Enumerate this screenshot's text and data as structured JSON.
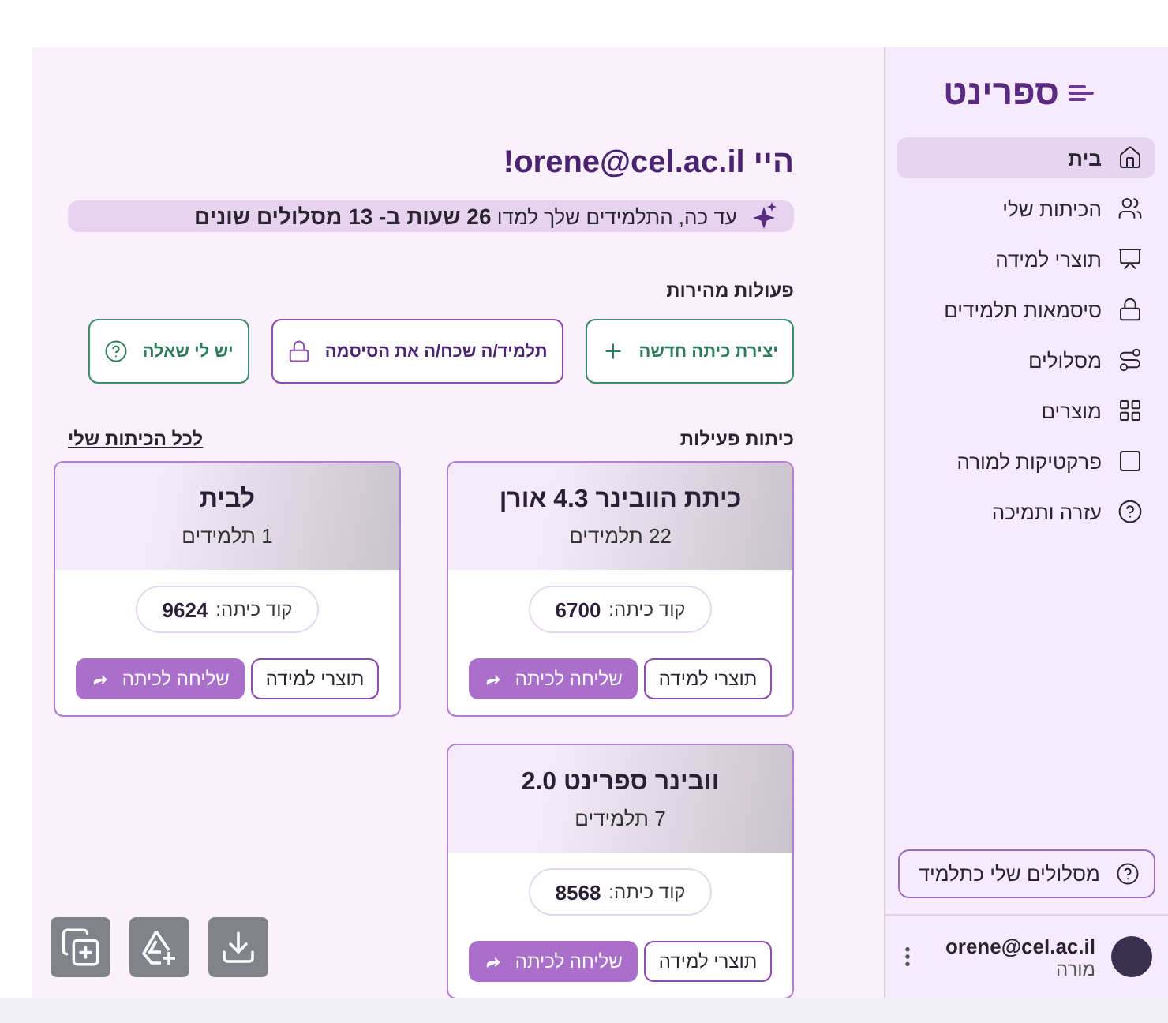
{
  "logo": "ספרינט",
  "nav": [
    {
      "label": "בית",
      "selected": true
    },
    {
      "label": "הכיתות שלי",
      "selected": false
    },
    {
      "label": "תוצרי למידה",
      "selected": false
    },
    {
      "label": "סיסמאות תלמידים",
      "selected": false
    },
    {
      "label": "מסלולים",
      "selected": false
    },
    {
      "label": "מוצרים",
      "selected": false
    },
    {
      "label": "פרקטיקות למורה",
      "selected": false
    },
    {
      "label": "עזרה ותמיכה",
      "selected": false
    }
  ],
  "student_paths_button": "מסלולים שלי כתלמיד",
  "user": {
    "email": "orene@cel.ac.il",
    "role": "מורה"
  },
  "greeting": "היי orene@cel.ac.il!",
  "banner": "עד כה, התלמידים שלך למדו **26 שעות ב- 13 מסלולים שונים**",
  "quick_actions": {
    "title": "פעולות מהירות",
    "buttons": [
      {
        "label": "יצירת כיתה חדשה",
        "kind": "create"
      },
      {
        "label": "תלמיד/ה שכח/ה את הסיסמה",
        "kind": "password"
      },
      {
        "label": "יש לי שאלה",
        "kind": "question"
      }
    ]
  },
  "classes": {
    "title": "כיתות פעילות",
    "link": "לכל הכיתות שלי",
    "cards": [
      {
        "name": "כיתת הוובינר 4.3 אורן",
        "students": "22 תלמידים",
        "code_label": "קוד כיתה:",
        "code": "6700",
        "results_button": "תוצרי למידה",
        "send_button": "שליחה לכיתה"
      },
      {
        "name": "לבית",
        "students": "1 תלמידים",
        "code_label": "קוד כיתה:",
        "code": "9624",
        "results_button": "תוצרי למידה",
        "send_button": "שליחה לכיתה"
      },
      {
        "name": "וובינר ספרינט 2.0",
        "students": "7 תלמידים",
        "code_label": "קוד כיתה:",
        "code": "8568",
        "results_button": "תוצרי למידה",
        "send_button": "שליחה לכיתה"
      }
    ]
  }
}
